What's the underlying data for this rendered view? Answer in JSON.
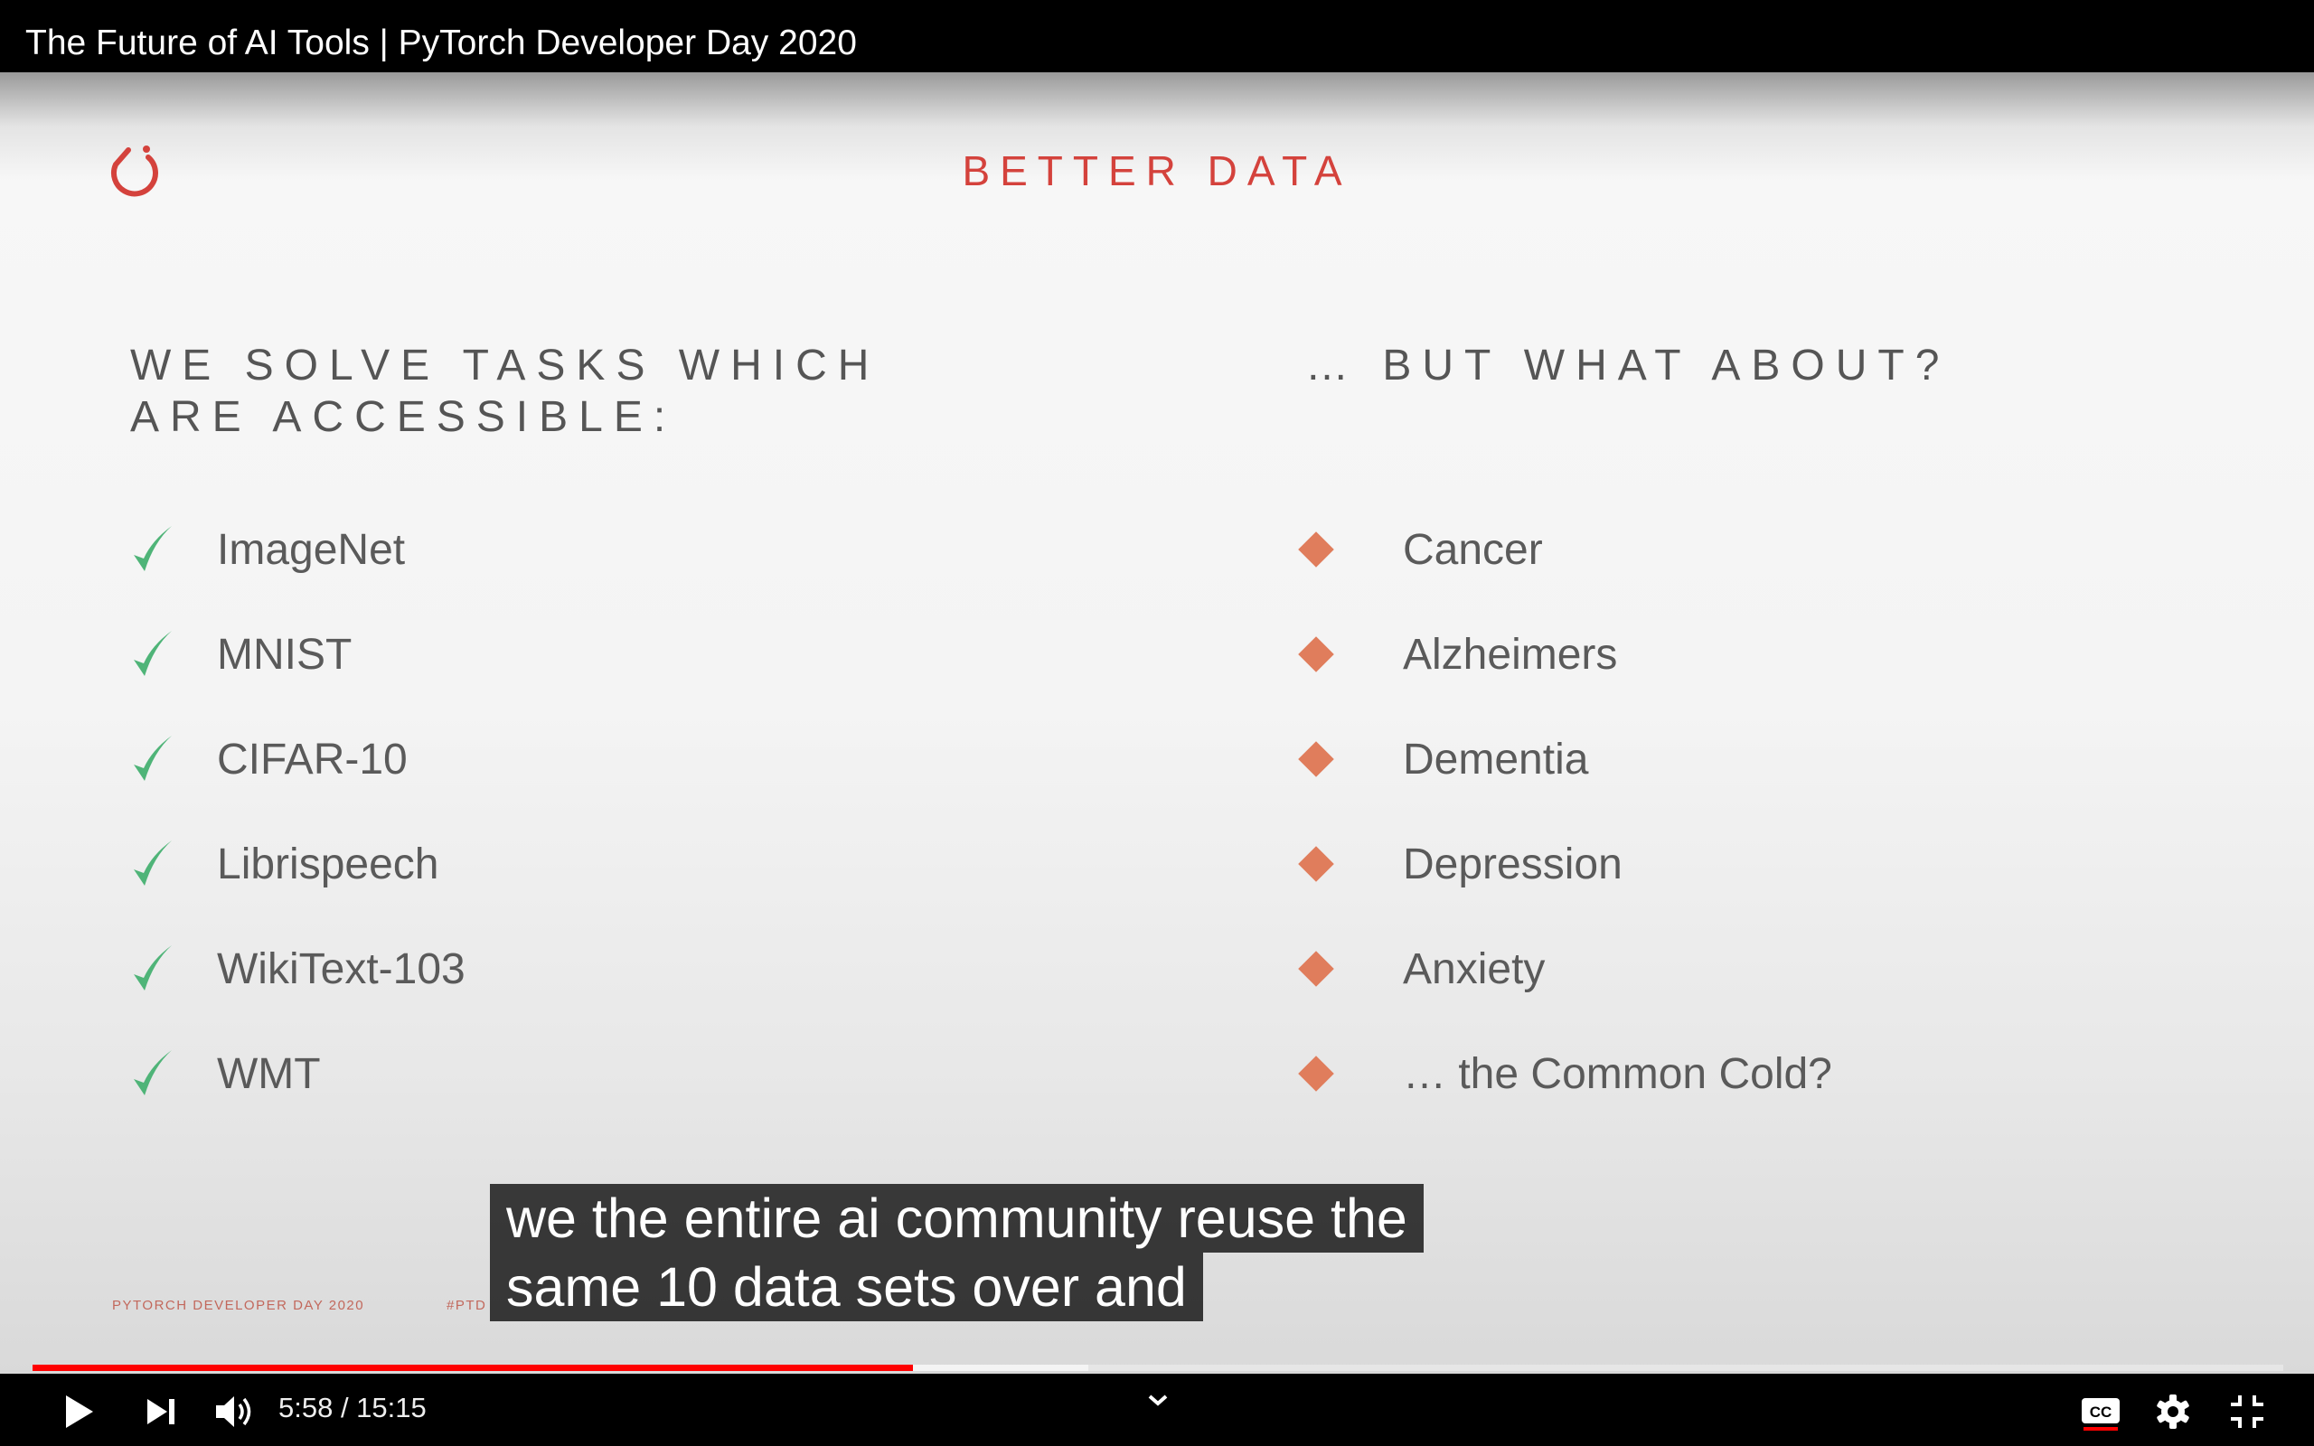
{
  "window": {
    "title": "The Future of AI Tools | PyTorch Developer Day 2020"
  },
  "slide": {
    "title": "BETTER DATA",
    "left_heading_line1": "WE SOLVE TASKS WHICH",
    "left_heading_line2": "ARE ACCESSIBLE:",
    "right_heading": "… BUT WHAT ABOUT?",
    "left_items": [
      "ImageNet",
      "MNIST",
      "CIFAR-10",
      "Librispeech",
      "WikiText-103",
      "WMT"
    ],
    "right_items": [
      "Cancer",
      "Alzheimers",
      "Dementia",
      "Depression",
      "Anxiety",
      "… the Common Cold?"
    ],
    "footer_left": "PYTORCH DEVELOPER DAY 2020",
    "footer_hashtag": "#PTD",
    "title_color": "#d4423c",
    "check_color": "#4fb478",
    "diamond_color": "#e07d5c"
  },
  "captions": {
    "line1": "we the entire ai community reuse the",
    "line2": "same 10 data sets over and"
  },
  "player": {
    "current_time": "5:58",
    "duration": "15:15",
    "time_display": "5:58 / 15:15",
    "progress_fraction": 0.391,
    "buffered_fraction": 0.469,
    "progress_color": "#ff0000",
    "icons": [
      "play-icon",
      "next-icon",
      "volume-icon",
      "chevron-down-icon",
      "captions-icon",
      "settings-icon",
      "exit-fullscreen-icon"
    ]
  }
}
